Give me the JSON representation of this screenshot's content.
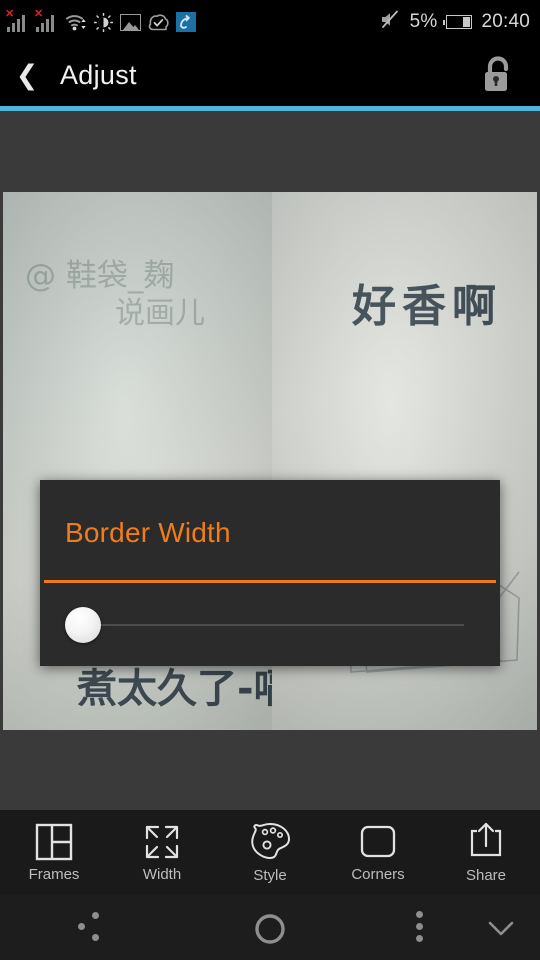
{
  "statusbar": {
    "icons": [
      {
        "name": "signal-1-icon",
        "label": "signal bars with error"
      },
      {
        "name": "signal-2-icon",
        "label": "signal bars with error"
      },
      {
        "name": "wifi-icon",
        "label": "wifi with data arrows"
      },
      {
        "name": "brightness-icon",
        "label": "auto brightness"
      },
      {
        "name": "gallery-icon",
        "label": "image"
      },
      {
        "name": "cloud-check-icon",
        "label": "sync complete"
      },
      {
        "name": "blue-app-icon",
        "label": "app notification"
      }
    ],
    "mute_icon": "mute-icon",
    "battery_percent": "5%",
    "battery_icon": "battery-icon",
    "time": "20:40"
  },
  "titlebar": {
    "back_icon": "back-chevron-icon",
    "title": "Adjust",
    "lock_icon": "unlock-icon",
    "accent_color": "#4fb5dd"
  },
  "canvas": {
    "background": "#3a3a3a",
    "collage": {
      "panes": [
        {
          "name": "photo-pane-left",
          "texts": [
            "@ 鞋袋_麹",
            "说画儿",
            "煮太久了-嗝"
          ],
          "description": "handwritten note with ink drawing"
        },
        {
          "name": "photo-pane-right",
          "texts": [
            "好香啊"
          ],
          "description": "handwritten note with pencil sketch of a box"
        }
      ]
    }
  },
  "dialog": {
    "title": "Border Width",
    "title_color": "#f07d1a",
    "rule_color": "#f2791a",
    "slider": {
      "name": "border-width-slider",
      "value": 0,
      "min": 0,
      "max": 100
    }
  },
  "toolbar": {
    "items": [
      {
        "label": "Frames",
        "icon": "frames-grid-icon"
      },
      {
        "label": "Width",
        "icon": "expand-arrows-icon"
      },
      {
        "label": "Style",
        "icon": "palette-icon"
      },
      {
        "label": "Corners",
        "icon": "rounded-square-icon"
      },
      {
        "label": "Share",
        "icon": "share-upload-icon"
      }
    ]
  },
  "navbar": {
    "recents_icon": "recents-dots-icon",
    "home_icon": "home-circle-icon",
    "menu_icon": "overflow-menu-icon",
    "hide_icon": "chevron-down-icon"
  }
}
